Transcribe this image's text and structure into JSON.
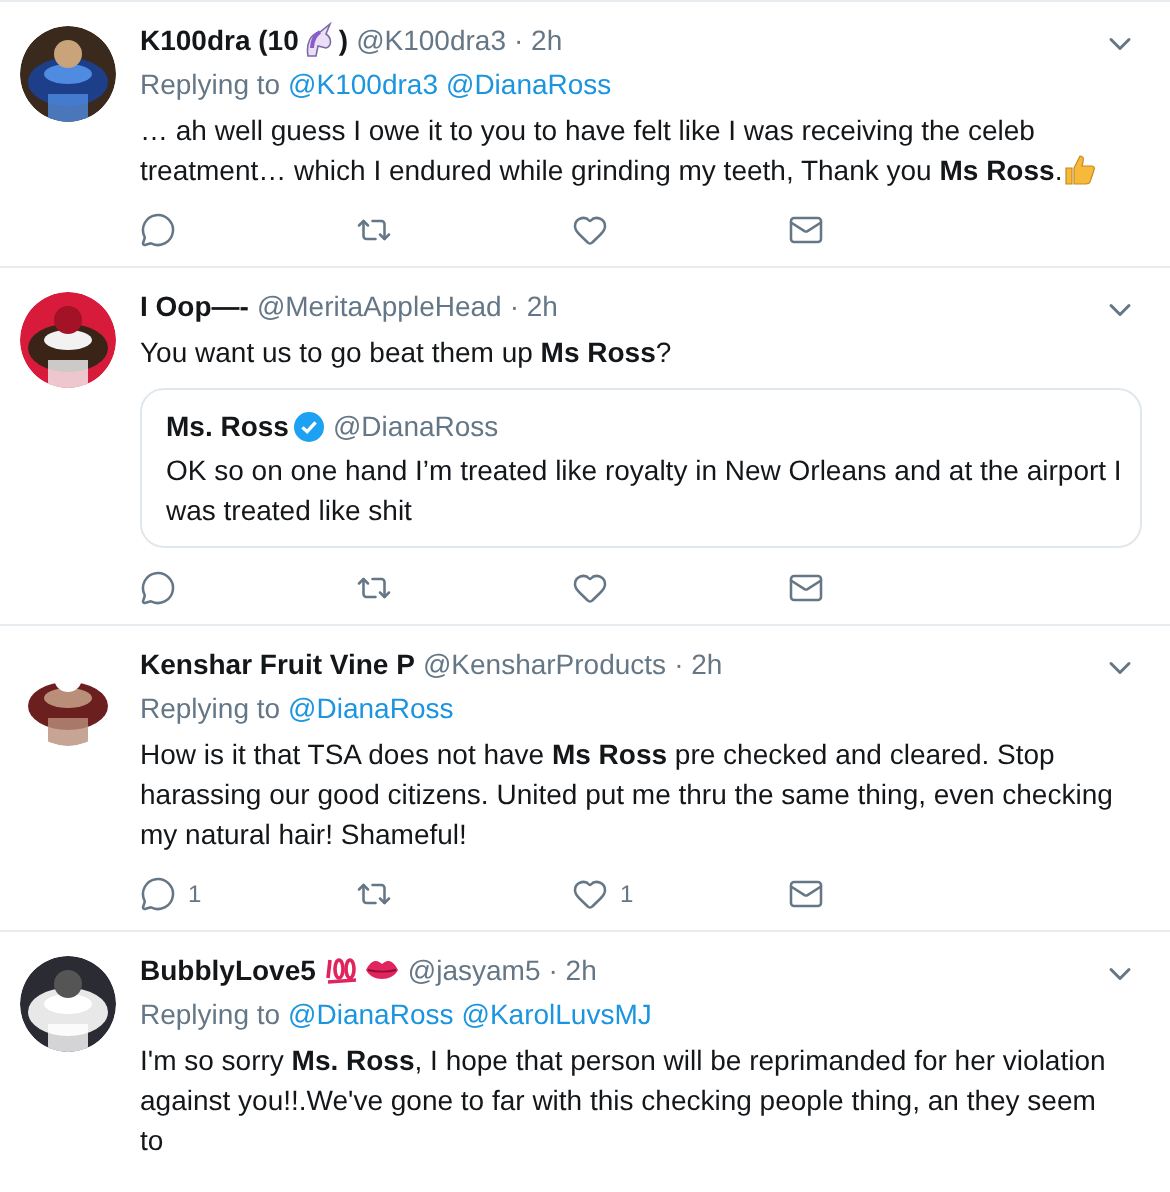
{
  "tweets": [
    {
      "avatar": {
        "kind": "picture"
      },
      "name_parts": [
        {
          "kind": "text",
          "text": "K100dra (10"
        },
        {
          "kind": "unicorn"
        },
        {
          "kind": "text",
          "text": ")"
        }
      ],
      "handle": "@K100dra3",
      "time": "· 2h",
      "replying_label": "Replying to",
      "reply_to": [
        "@K100dra3",
        "@DianaRoss"
      ],
      "text": "… ah well guess I owe it to you to have felt like I was receiving the celeb treatment…  which I endured while grinding my teeth, Thank you **Ms Ross**.",
      "trailing": {
        "kind": "thumbs"
      },
      "actions": [
        {
          "kind": "reply"
        },
        {
          "kind": "retweet"
        },
        {
          "kind": "like"
        },
        {
          "kind": "message"
        }
      ]
    },
    {
      "avatar": {
        "kind": "picture"
      },
      "name_parts": [
        {
          "kind": "text",
          "text": "I Oop—-"
        }
      ],
      "handle": "@MeritaAppleHead",
      "time": "· 2h",
      "text": "You want us to go beat them up **Ms Ross**?",
      "quote": {
        "name": "Ms. Ross",
        "verified": true,
        "handle": "@DianaRoss",
        "text": "OK so on one hand I’m treated like royalty in New Orleans and at the airport I was treated like shit"
      },
      "actions": [
        {
          "kind": "reply"
        },
        {
          "kind": "retweet"
        },
        {
          "kind": "like"
        },
        {
          "kind": "message"
        }
      ]
    },
    {
      "avatar": {
        "kind": "picture"
      },
      "name_parts": [
        {
          "kind": "text",
          "text": "Kenshar Fruit Vine P"
        }
      ],
      "handle": "@KensharProducts",
      "time": "· 2h",
      "replying_label": "Replying to",
      "reply_to": [
        "@DianaRoss"
      ],
      "text": "How is it that TSA does not have **Ms Ross** pre checked and cleared. Stop harassing our good citizens. United put me thru the same thing, even checking my natural hair! Shameful!",
      "actions": [
        {
          "kind": "reply",
          "count": "1"
        },
        {
          "kind": "retweet"
        },
        {
          "kind": "like",
          "count": "1"
        },
        {
          "kind": "message"
        }
      ]
    },
    {
      "avatar": {
        "kind": "picture"
      },
      "name_parts": [
        {
          "kind": "text",
          "text": "BubblyLove5"
        },
        {
          "kind": "hundred"
        },
        {
          "kind": "lips"
        }
      ],
      "handle": "@jasyam5",
      "time": "· 2h",
      "replying_label": "Replying to",
      "reply_to": [
        "@DianaRoss",
        "@KarolLuvsMJ"
      ],
      "text": "I'm so sorry **Ms. Ross**, I hope that person will be reprimanded for her violation against you!!.We've gone to far with this checking people thing, an they seem to"
    }
  ]
}
